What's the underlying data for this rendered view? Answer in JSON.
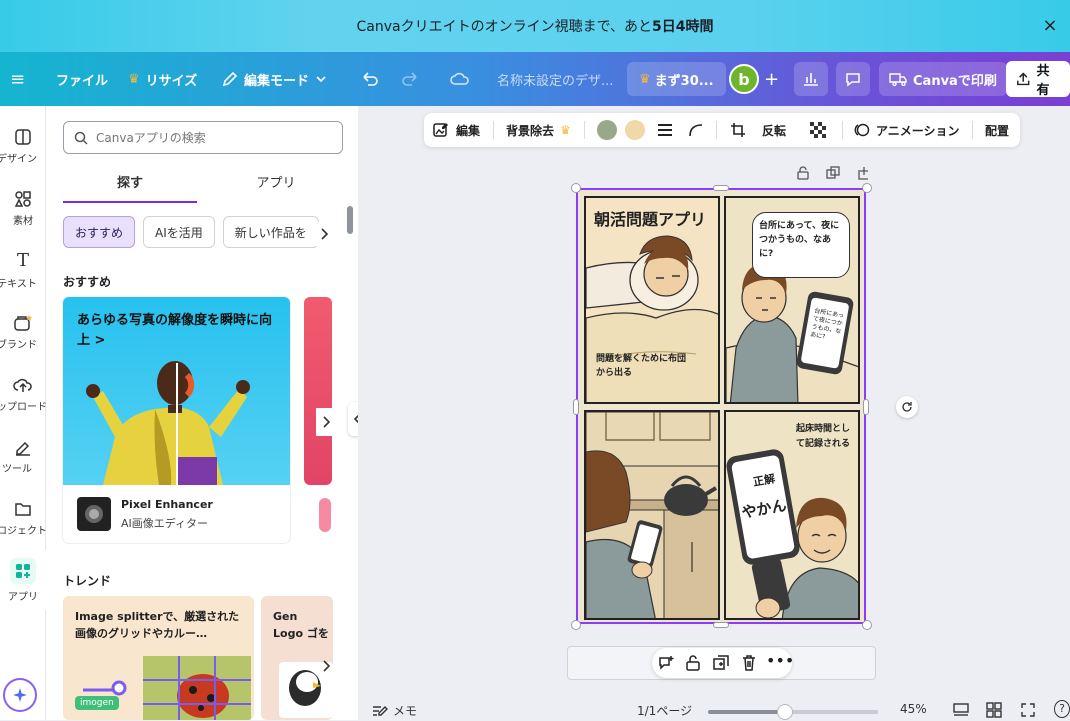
{
  "banner": {
    "text_pre": "Canvaクリエイトのオンライン視聴まで、あと",
    "text_bold": "5日4時間",
    "close": "×"
  },
  "topbar": {
    "menu": "≡",
    "file": "ファイル",
    "resize": "リサイズ",
    "edit_mode": "編集モード",
    "doc_title": "名称未設定のデザ...",
    "trial": "まず30...",
    "avatar_letter": "b",
    "print": "Canvaで印刷",
    "share": "共有"
  },
  "rail": [
    {
      "label": "デザイン"
    },
    {
      "label": "素材"
    },
    {
      "label": "テキスト"
    },
    {
      "label": "ブランド"
    },
    {
      "label": "アップロード"
    },
    {
      "label": "ツール"
    },
    {
      "label": "プロジェクト"
    },
    {
      "label": "アプリ"
    }
  ],
  "panel": {
    "search_placeholder": "Canvaアプリの検索",
    "tabs": [
      "探す",
      "アプリ"
    ],
    "chips": [
      "おすすめ",
      "AIを活用",
      "新しい作品を"
    ],
    "section_recommended": "おすすめ",
    "feature_card": {
      "headline": "あらゆる写真の解像度を瞬時に向上 >",
      "app_name": "Pixel Enhancer",
      "app_sub": "AI画像エディター"
    },
    "section_trend": "トレンド",
    "trend_cards": [
      {
        "title": "Image splitterで、厳選された画像のグリッドやカルー…",
        "badge": "imogen"
      },
      {
        "title": "Gen Logo ゴを作成"
      }
    ]
  },
  "context_toolbar": {
    "edit": "編集",
    "bg_remove": "背景除去",
    "color1": "#9aa88a",
    "color2": "#f0d8a8",
    "flip": "反転",
    "animation": "アニメーション",
    "arrange": "配置"
  },
  "comic": {
    "title": "朝活問題アプリ",
    "panel1_caption": "問題を解くために布団から出る",
    "panel2_bubble": "台所にあって、夜につかうもの、なあに?",
    "panel2_phone": "台所にあって夜につかうもの、なあに?",
    "panel4_caption": "起床時間として記録される",
    "panel4_board_top": "正解",
    "panel4_board": "やかん"
  },
  "bottom": {
    "notes": "メモ",
    "page_indicator": "1/1ページ",
    "zoom": "45%",
    "zoom_value": 0.45
  }
}
